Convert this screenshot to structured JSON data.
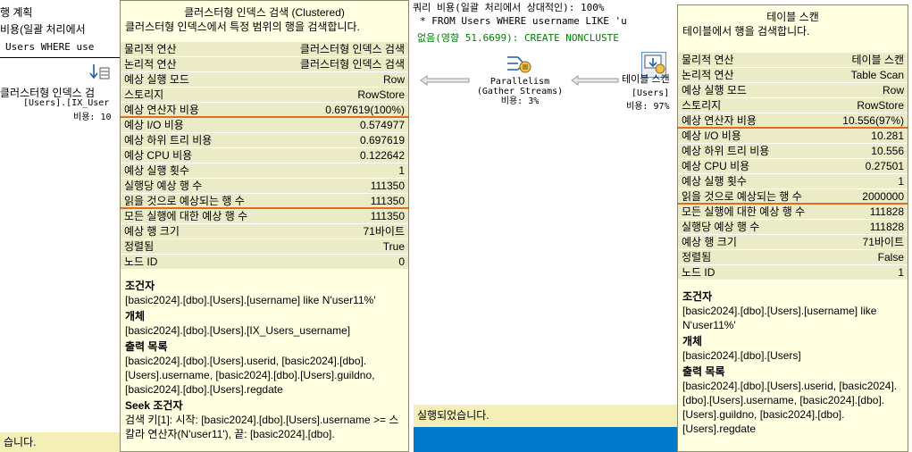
{
  "background": {
    "tab_fragment": "행 계획",
    "left_line1": "비용(일괄 처리에서",
    "left_line2": "Users WHERE use",
    "left_op_label": "클러스터형 인덱스 검",
    "left_op_obj": "[Users].[IX_User",
    "left_op_cost": "비용: 10",
    "mid_line1": "쿼리 비용(일괄 처리에서 상대적인): 100%",
    "mid_line2": "* FROM Users WHERE username LIKE 'u",
    "mid_line3": "없음(영향 51.6699): CREATE NONCLUSTE",
    "parallelism_name": "Parallelism",
    "parallelism_sub": "(Gather Streams)",
    "parallelism_cost": "비용: 3%",
    "tablescan_fragment": "테이블 스캔",
    "tablescan_obj": "[Users]",
    "tablescan_cost": "비용: 97%",
    "status_left": "습니다.",
    "status_mid": "실행되었습니다."
  },
  "left_tooltip": {
    "title": "클러스터형 인덱스 검색 (Clustered)",
    "description": "클러스터형 인덱스에서 특정 범위의 행을 검색합니다.",
    "rows": [
      {
        "label": "물리적 연산",
        "value": "클러스터형 인덱스 검색"
      },
      {
        "label": "논리적 연산",
        "value": "클러스터형 인덱스 검색"
      },
      {
        "label": "예상 실행 모드",
        "value": "Row"
      },
      {
        "label": "스토리지",
        "value": "RowStore"
      },
      {
        "label": "예상 연산자 비용",
        "value": "0.697619(100%)"
      },
      {
        "label": "예상 I/O 비용",
        "value": "0.574977"
      },
      {
        "label": "예상 하위 트리 비용",
        "value": "0.697619"
      },
      {
        "label": "예상 CPU 비용",
        "value": "0.122642"
      },
      {
        "label": "예상 실행 횟수",
        "value": "1"
      },
      {
        "label": "실행당 예상 행 수",
        "value": "111350"
      },
      {
        "label": "읽을 것으로 예상되는 행 수",
        "value": "111350"
      },
      {
        "label": "모든 실행에 대한 예상 행 수",
        "value": "111350"
      },
      {
        "label": "예상 행 크기",
        "value": "71바이트"
      },
      {
        "label": "정렬됨",
        "value": "True"
      },
      {
        "label": "노드 ID",
        "value": "0"
      }
    ],
    "predicate_header": "조건자",
    "predicate": "[basic2024].[dbo].[Users].[username] like N'user11%'",
    "object_header": "개체",
    "object": "[basic2024].[dbo].[Users].[IX_Users_username]",
    "output_header": "출력 목록",
    "output": "[basic2024].[dbo].[Users].userid, [basic2024].[dbo].[Users].username, [basic2024].[dbo].[Users].guildno, [basic2024].[dbo].[Users].regdate",
    "seek_header": "Seek 조건자",
    "seek": "검색 키[1]: 시작: [basic2024].[dbo].[Users].username >= 스칼라 연산자(N'user11'), 끝: [basic2024].[dbo]."
  },
  "right_tooltip": {
    "title": "테이블 스캔",
    "description": "테이블에서 행을 검색합니다.",
    "rows": [
      {
        "label": "물리적 연산",
        "value": "테이블 스캔"
      },
      {
        "label": "논리적 연산",
        "value": "Table Scan"
      },
      {
        "label": "예상 실행 모드",
        "value": "Row"
      },
      {
        "label": "스토리지",
        "value": "RowStore"
      },
      {
        "label": "예상 연산자 비용",
        "value": "10.556(97%)"
      },
      {
        "label": "예상 I/O 비용",
        "value": "10.281"
      },
      {
        "label": "예상 하위 트리 비용",
        "value": "10.556"
      },
      {
        "label": "예상 CPU 비용",
        "value": "0.27501"
      },
      {
        "label": "예상 실행 횟수",
        "value": "1"
      },
      {
        "label": "읽을 것으로 예상되는 행 수",
        "value": "2000000"
      },
      {
        "label": "모든 실행에 대한 예상 행 수",
        "value": "111828"
      },
      {
        "label": "실행당 예상 행 수",
        "value": "111828"
      },
      {
        "label": "예상 행 크기",
        "value": "71바이트"
      },
      {
        "label": "정렬됨",
        "value": "False"
      },
      {
        "label": "노드 ID",
        "value": "1"
      }
    ],
    "predicate_header": "조건자",
    "predicate": "[basic2024].[dbo].[Users].[username] like N'user11%'",
    "object_header": "개체",
    "object": "[basic2024].[dbo].[Users]",
    "output_header": "출력 목록",
    "output": "[basic2024].[dbo].[Users].userid, [basic2024].[dbo].[Users].username, [basic2024].[dbo].[Users].guildno, [basic2024].[dbo].[Users].regdate"
  },
  "colors": {
    "tooltip_bg": "#ffffe1",
    "row_highlight": "#ebebc8",
    "underline": "#e06c1e",
    "status_bg": "#f3efb6",
    "accent_blue": "#007acc",
    "sql_green": "#008000"
  }
}
